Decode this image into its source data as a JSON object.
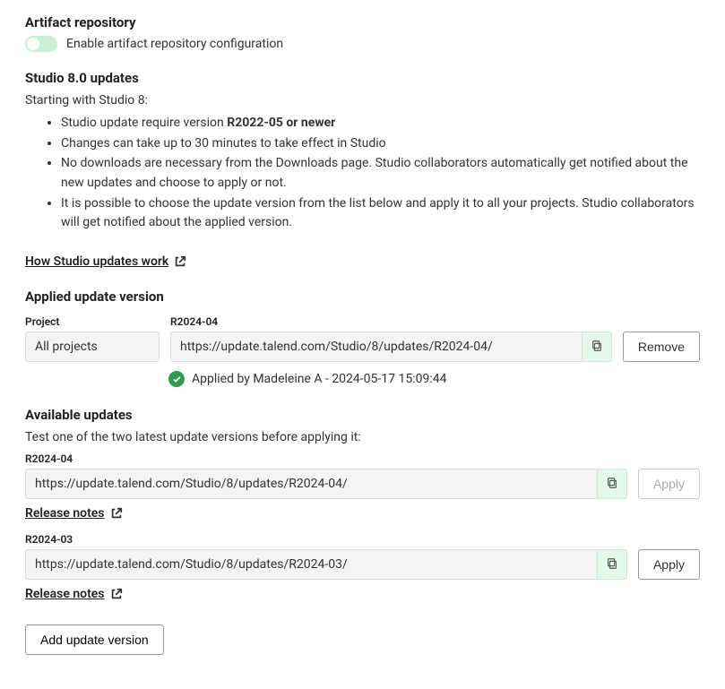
{
  "artifact": {
    "title": "Artifact repository",
    "toggle_label": "Enable artifact repository configuration"
  },
  "studio": {
    "title": "Studio 8.0 updates",
    "intro": "Starting with Studio 8:",
    "bullets": {
      "b1_prefix": "Studio update require version ",
      "b1_strong": "R2022-05 or newer",
      "b2": "Changes can take up to 30 minutes to take effect in Studio",
      "b3": "No downloads are necessary from the Downloads page. Studio collaborators automatically get notified about the new updates and choose to apply or not.",
      "b4": "It is possible to choose the update version from the list below and apply it to all your projects. Studio collaborators will get notified about the applied version."
    },
    "how_link": "How Studio updates work"
  },
  "applied": {
    "title": "Applied update version",
    "project_label": "Project",
    "project_value": "All projects",
    "version_label": "R2024-04",
    "url": "https://update.talend.com/Studio/8/updates/R2024-04/",
    "remove": "Remove",
    "status": "Applied by Madeleine A - 2024-05-17 15:09:44"
  },
  "available": {
    "title": "Available updates",
    "subtitle": "Test one of the two latest update versions before applying it:",
    "items": [
      {
        "version": "R2024-04",
        "url": "https://update.talend.com/Studio/8/updates/R2024-04/",
        "apply": "Apply",
        "applied": true
      },
      {
        "version": "R2024-03",
        "url": "https://update.talend.com/Studio/8/updates/R2024-03/",
        "apply": "Apply",
        "applied": false
      }
    ],
    "release_notes": "Release notes",
    "add_button": "Add update version"
  }
}
